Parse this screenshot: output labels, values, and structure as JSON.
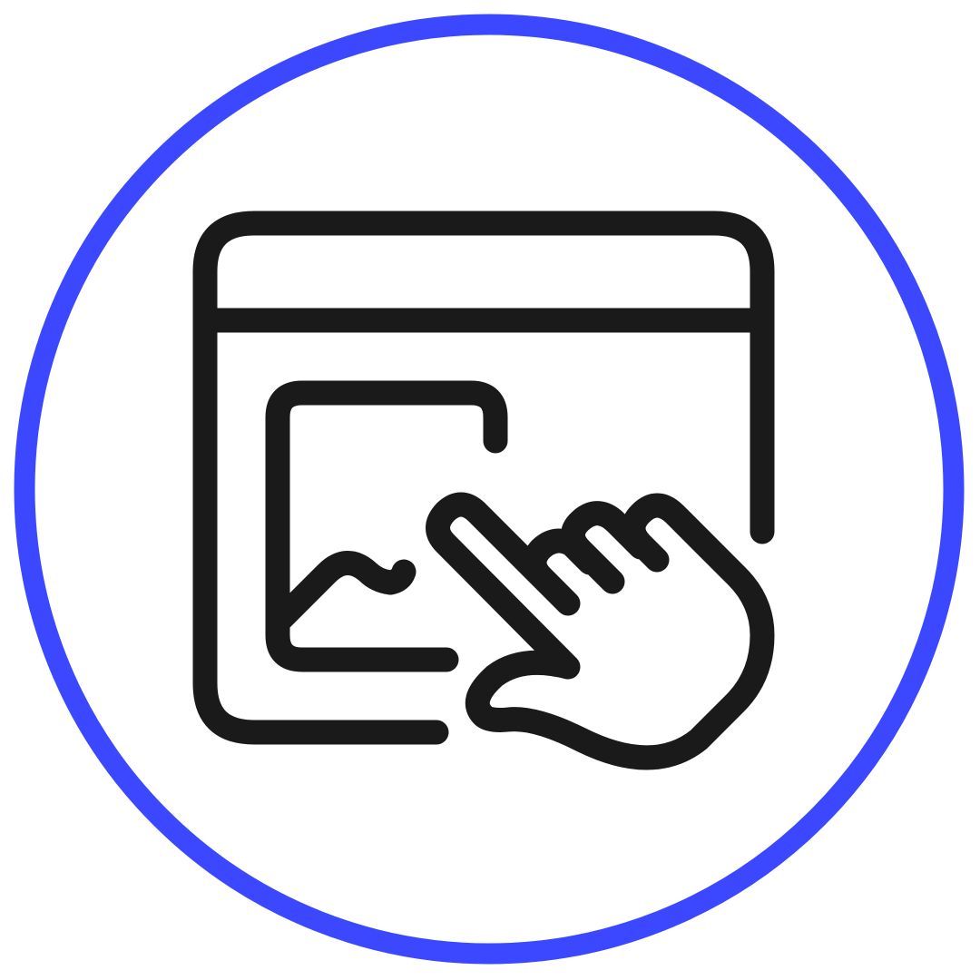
{
  "icon": {
    "name": "browser-window-touch-image-icon",
    "ring_color": "#3b48ff",
    "stroke_color": "#1a1a1a",
    "background_color": "#ffffff"
  }
}
